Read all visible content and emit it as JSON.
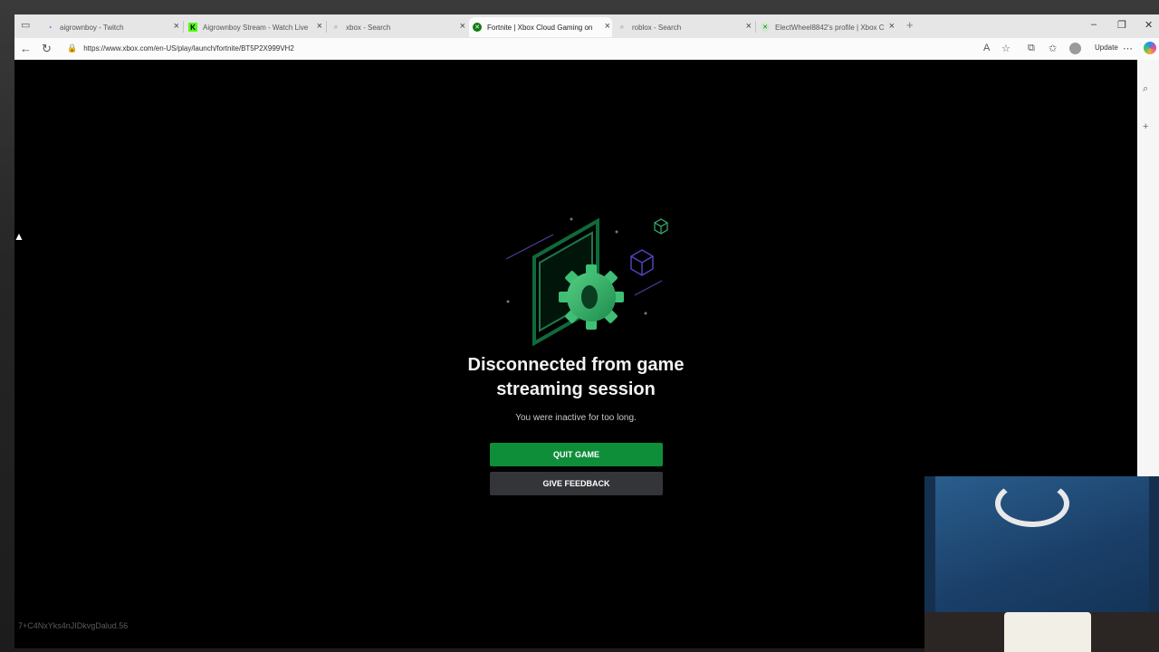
{
  "browser": {
    "tabs": [
      {
        "title": "aigrownboy - Twitch",
        "icon": "twitch-icon",
        "active": false
      },
      {
        "title": "Aigrownboy Stream - Watch Live",
        "icon": "kick-icon",
        "active": false
      },
      {
        "title": "xbox - Search",
        "icon": "search-icon",
        "active": false
      },
      {
        "title": "Fortnite | Xbox Cloud Gaming on",
        "icon": "xbox-icon",
        "active": true
      },
      {
        "title": "roblox - Search",
        "icon": "search-icon",
        "active": false
      },
      {
        "title": "ElectWheel8842's profile | Xbox C",
        "icon": "xbox-icon",
        "active": false
      }
    ],
    "url": "https://www.xbox.com/en-US/play/launch/fortnite/BT5P2X999VH2",
    "update_label": "Update"
  },
  "dialog": {
    "title_line1": "Disconnected from game",
    "title_line2": "streaming session",
    "message": "You were inactive for too long.",
    "quit_label": "QUIT GAME",
    "feedback_label": "GIVE FEEDBACK"
  },
  "session_code": "7+C4NxYks4nJIDkvgDalud.56",
  "colors": {
    "accent_green": "#0f8e3a",
    "secondary_button": "#333538",
    "viewport_bg": "#000000"
  }
}
